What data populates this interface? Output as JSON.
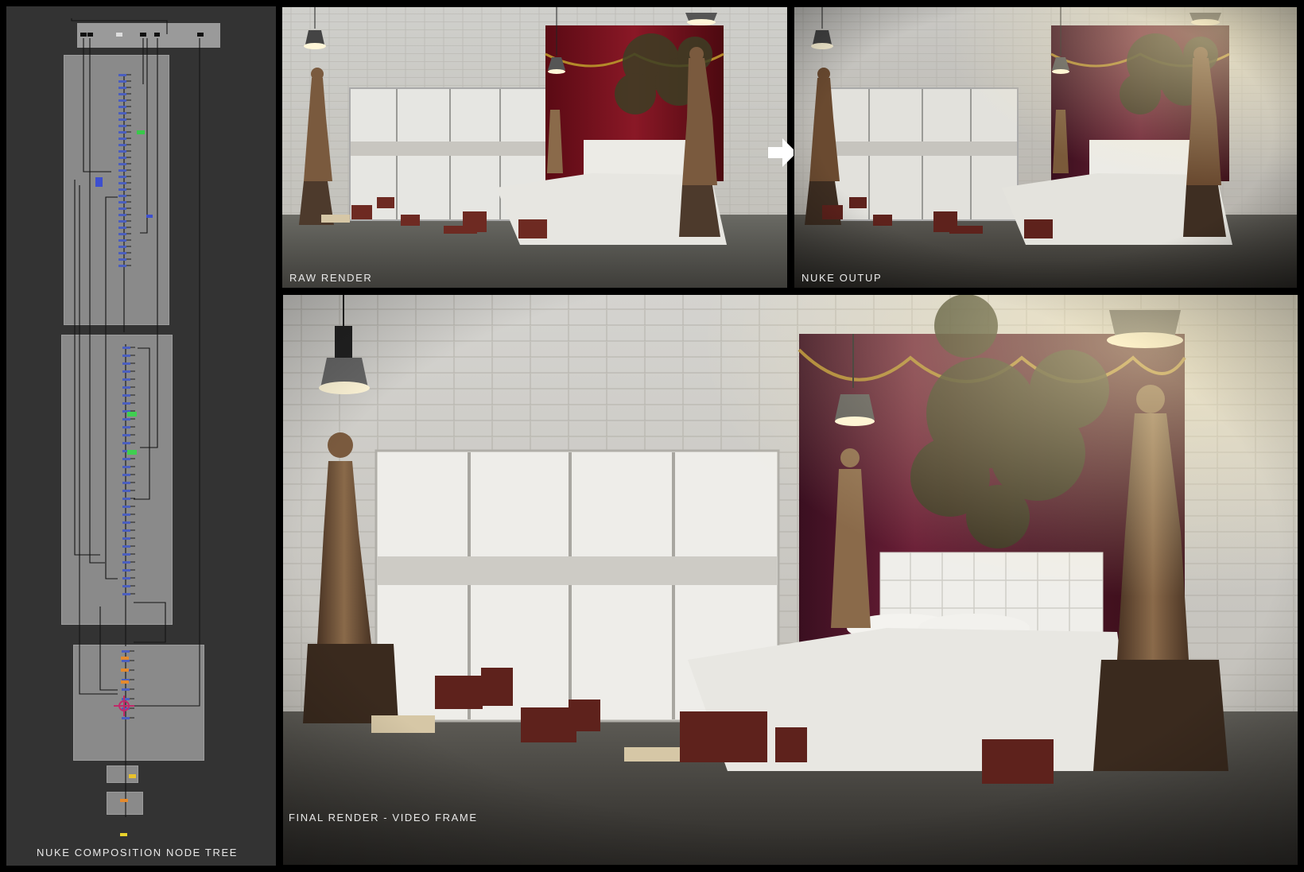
{
  "panels": {
    "node_tree_label": "NUKE COMPOSITION NODE TREE",
    "raw_label": "RAW RENDER",
    "nuke_label": "NUKE OUTUP",
    "final_label": "FINAL RENDER - VIDEO FRAME"
  },
  "icons": {
    "arrow": "right-arrow-icon",
    "lamp": "pendant-lamp-icon",
    "statue": "statue-icon",
    "bed": "bed-icon",
    "books": "book-stack-icon"
  },
  "colors": {
    "frame_background": "#000000",
    "node_panel_background": "#333333",
    "backdrop_gray": "#8a8a8a",
    "label_text": "#e9e9e9",
    "curtain_red": "#6b0f1c",
    "curtain_purple": "#4a1526",
    "node_blue": "#4b5fbf"
  }
}
